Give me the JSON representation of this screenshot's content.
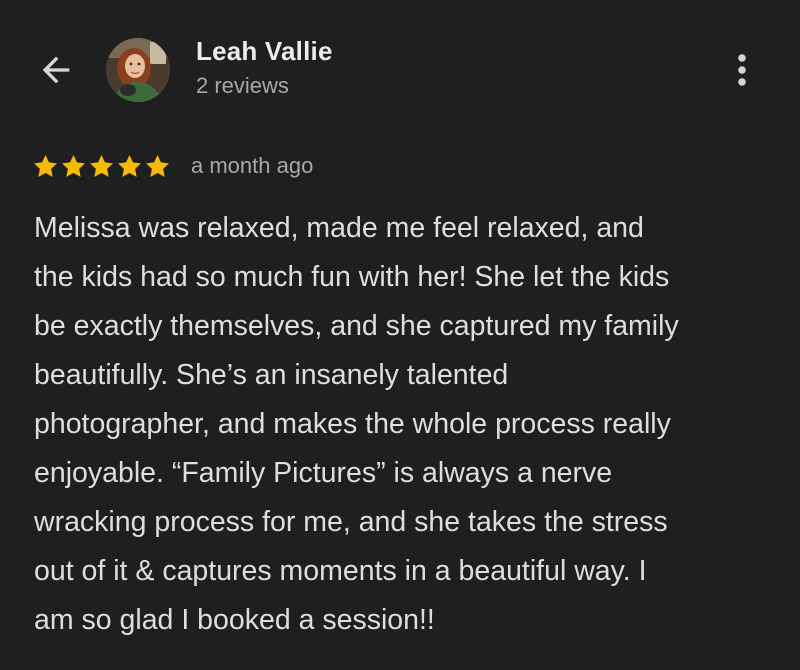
{
  "header": {
    "back_icon": "arrow-back-icon",
    "avatar_icon": "user-avatar",
    "reviewer_name": "Leah Vallie",
    "review_count": "2 reviews",
    "more_icon": "more-vert-icon"
  },
  "review": {
    "rating": 5,
    "rating_max": 5,
    "star_color": "#f6bb06",
    "date": "a month ago",
    "text": "Melissa was relaxed, made me feel relaxed, and\nthe kids had so much fun with her! She let the kids\nbe exactly themselves, and she captured my family\nbeautifully. She’s an insanely talented\nphotographer, and makes the whole process really\nenjoyable. “Family Pictures” is always a nerve\nwracking process for me, and she takes the stress\nout of it & captures moments in a beautiful way. I\nam so glad I booked a session!!"
  },
  "colors": {
    "background": "#1f1f1f",
    "primary_text": "#e3e3e3",
    "secondary_text": "#a8a8a8"
  }
}
